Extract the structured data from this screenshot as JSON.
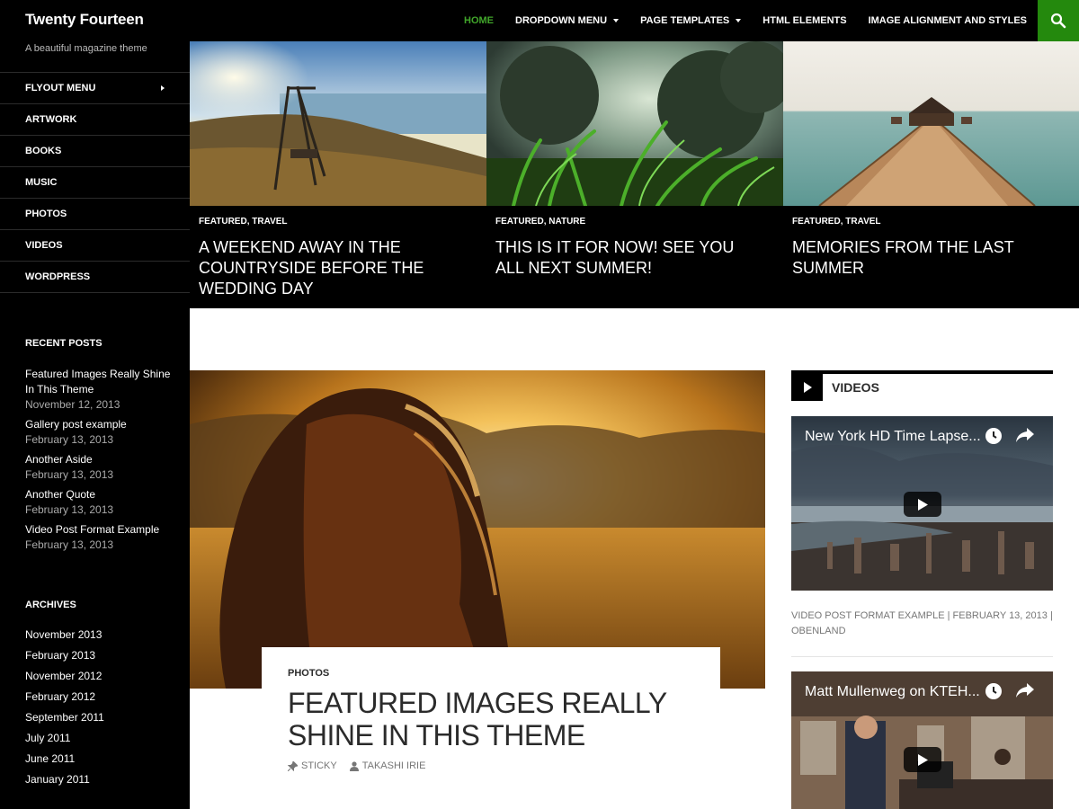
{
  "site": {
    "title": "Twenty Fourteen",
    "tagline": "A beautiful magazine theme"
  },
  "nav": {
    "items": [
      {
        "label": "HOME",
        "active": true
      },
      {
        "label": "DROPDOWN MENU",
        "dropdown": true
      },
      {
        "label": "PAGE TEMPLATES",
        "dropdown": true
      },
      {
        "label": "HTML ELEMENTS"
      },
      {
        "label": "IMAGE ALIGNMENT AND STYLES"
      }
    ],
    "search_icon": "search-icon",
    "accent_color": "#41a62a",
    "search_bg": "#24890d"
  },
  "sidebar": {
    "menu": [
      "FLYOUT MENU",
      "ARTWORK",
      "BOOKS",
      "MUSIC",
      "PHOTOS",
      "VIDEOS",
      "WORDPRESS"
    ],
    "recent_posts": {
      "title": "RECENT POSTS",
      "items": [
        {
          "title": "Featured Images Really Shine In This Theme",
          "date": "November 12, 2013"
        },
        {
          "title": "Gallery post example",
          "date": "February 13, 2013"
        },
        {
          "title": "Another Aside",
          "date": "February 13, 2013"
        },
        {
          "title": "Another Quote",
          "date": "February 13, 2013"
        },
        {
          "title": "Video Post Format Example",
          "date": "February 13, 2013"
        }
      ]
    },
    "archives": {
      "title": "ARCHIVES",
      "items": [
        "November 2013",
        "February 2013",
        "November 2012",
        "February 2012",
        "September 2011",
        "July 2011",
        "June 2011",
        "January 2011"
      ]
    }
  },
  "featured": [
    {
      "category": "FEATURED, TRAVEL",
      "title": "A WEEKEND AWAY IN THE COUNTRYSIDE BEFORE THE WEDDING DAY"
    },
    {
      "category": "FEATURED, NATURE",
      "title": "THIS IS IT FOR NOW! SEE YOU ALL NEXT SUMMER!"
    },
    {
      "category": "FEATURED, TRAVEL",
      "title": "MEMORIES FROM THE LAST SUMMER"
    }
  ],
  "post": {
    "category": "PHOTOS",
    "title": "FEATURED IMAGES REALLY SHINE IN THIS THEME",
    "sticky": "STICKY",
    "author": "TAKASHI IRIE"
  },
  "videos_widget": {
    "title": "VIDEOS",
    "videos": [
      {
        "title": "New York HD Time Lapse..."
      },
      {
        "title": "Matt Mullenweg on KTEH..."
      }
    ],
    "meta": "VIDEO POST FORMAT EXAMPLE | FEBRUARY 13, 2013 | OBENLAND"
  }
}
